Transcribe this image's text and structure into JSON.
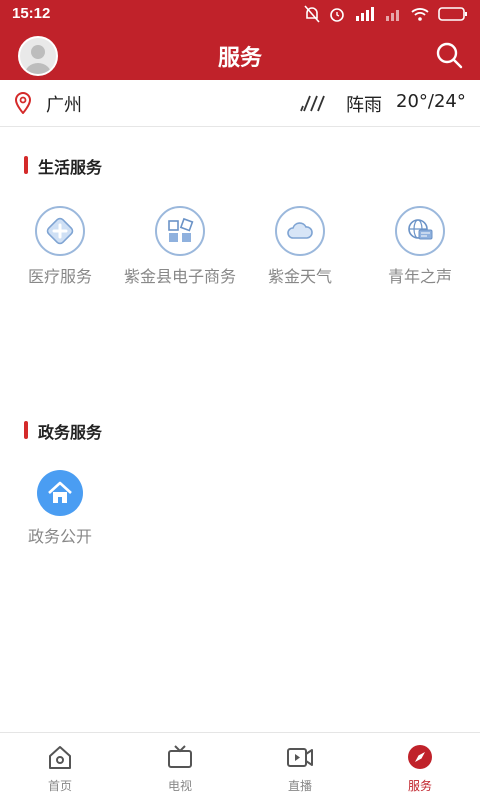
{
  "status": {
    "time": "15:12"
  },
  "header": {
    "title": "服务"
  },
  "weather": {
    "city": "广州",
    "condition": "阵雨",
    "temperature": "20°/24°"
  },
  "life_section": {
    "title": "生活服务",
    "items": [
      {
        "label": "医疗服务",
        "icon": "medical-cross-icon"
      },
      {
        "label": "紫金县电子商务",
        "icon": "grid-squares-icon"
      },
      {
        "label": "紫金天气",
        "icon": "cloud-icon"
      },
      {
        "label": "青年之声",
        "icon": "globe-message-icon"
      }
    ]
  },
  "gov_section": {
    "title": "政务服务",
    "items": [
      {
        "label": "政务公开",
        "icon": "home-icon"
      }
    ]
  },
  "bottom_nav": [
    {
      "label": "首页",
      "icon": "home-outline-icon"
    },
    {
      "label": "电视",
      "icon": "tv-icon"
    },
    {
      "label": "直播",
      "icon": "video-play-icon"
    },
    {
      "label": "服务",
      "icon": "compass-icon",
      "active": true
    }
  ],
  "colors": {
    "brand": "#c0222a",
    "accent_blue": "#4a9df2",
    "icon_outline": "#9bb8dc"
  }
}
